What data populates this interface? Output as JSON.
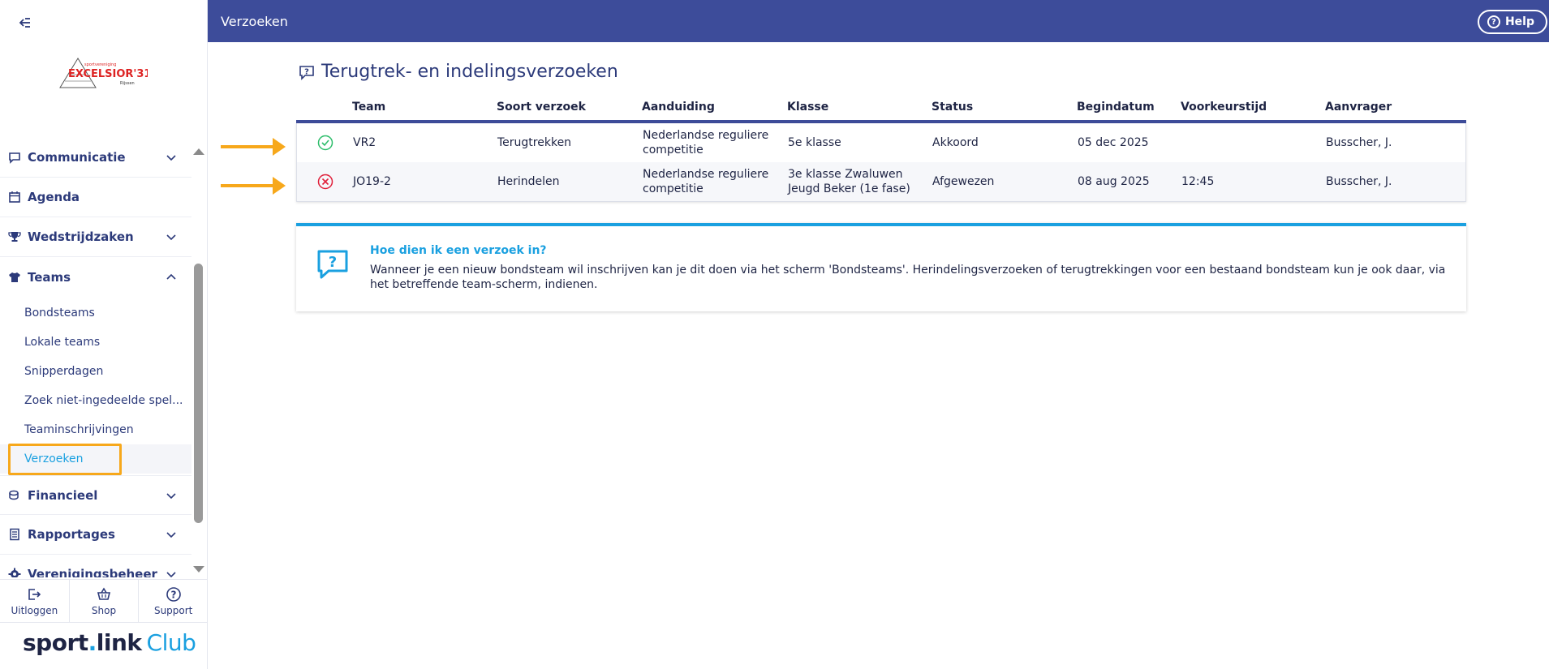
{
  "app": {
    "page_title": "Verzoeken",
    "help_label": "Help"
  },
  "logo": {
    "small_text": "sportvereniging",
    "name": "EXCELSIOR'31",
    "place": "Rijssen"
  },
  "sidebar": {
    "groups": [
      {
        "label": "Communicatie",
        "icon": "chat-icon",
        "expanded": false
      },
      {
        "label": "Agenda",
        "icon": "calendar-icon",
        "expanded": false
      },
      {
        "label": "Wedstrijdzaken",
        "icon": "trophy-icon",
        "expanded": false
      },
      {
        "label": "Teams",
        "icon": "shirt-icon",
        "expanded": true
      },
      {
        "label": "Financieel",
        "icon": "coins-icon",
        "expanded": false
      },
      {
        "label": "Rapportages",
        "icon": "report-icon",
        "expanded": false
      },
      {
        "label": "Verenigingsbeheer",
        "icon": "gear-icon",
        "expanded": false
      }
    ],
    "teams_items": [
      {
        "label": "Bondsteams"
      },
      {
        "label": "Lokale teams"
      },
      {
        "label": "Snipperdagen"
      },
      {
        "label": "Zoek niet-ingedeelde spel..."
      },
      {
        "label": "Teaminschrijvingen"
      },
      {
        "label": "Verzoeken",
        "active": true
      }
    ],
    "footer": {
      "logout": "Uitloggen",
      "shop": "Shop",
      "support": "Support"
    },
    "brand": {
      "sport": "sport",
      "dot": ".",
      "link": "link",
      "club": "Club"
    }
  },
  "main": {
    "heading": "Terugtrek- en indelingsverzoeken",
    "columns": [
      "Team",
      "Soort verzoek",
      "Aanduiding",
      "Klasse",
      "Status",
      "Begindatum",
      "Voorkeurstijd",
      "Aanvrager"
    ],
    "rows": [
      {
        "status_icon": "check-circle-icon",
        "team": "VR2",
        "soort": "Terugtrekken",
        "aanduiding": "Nederlandse reguliere competitie",
        "klasse": "5e klasse",
        "status": "Akkoord",
        "begindatum": "05 dec 2025",
        "voorkeurstijd": "",
        "aanvrager": "Busscher, J."
      },
      {
        "status_icon": "x-circle-icon",
        "team": "JO19-2",
        "soort": "Herindelen",
        "aanduiding": "Nederlandse reguliere competitie",
        "klasse": "3e klasse Zwaluwen Jeugd Beker (1e fase)",
        "status": "Afgewezen",
        "begindatum": "08 aug 2025",
        "voorkeurstijd": "12:45",
        "aanvrager": "Busscher, J."
      }
    ],
    "info": {
      "title": "Hoe dien ik een verzoek in?",
      "text": "Wanneer je een nieuw bondsteam wil inschrijven kan je dit doen via het scherm 'Bondsteams'. Herindelingsverzoeken of terugtrekkingen voor een bestaand bondsteam kun je ook daar, via het betreffende team-scherm, indienen."
    }
  },
  "colors": {
    "topbar": "#3d4c9a",
    "accent": "#1aa0e0",
    "highlight": "#f7a81b",
    "success": "#2ebd6b",
    "danger": "#e0203a"
  }
}
